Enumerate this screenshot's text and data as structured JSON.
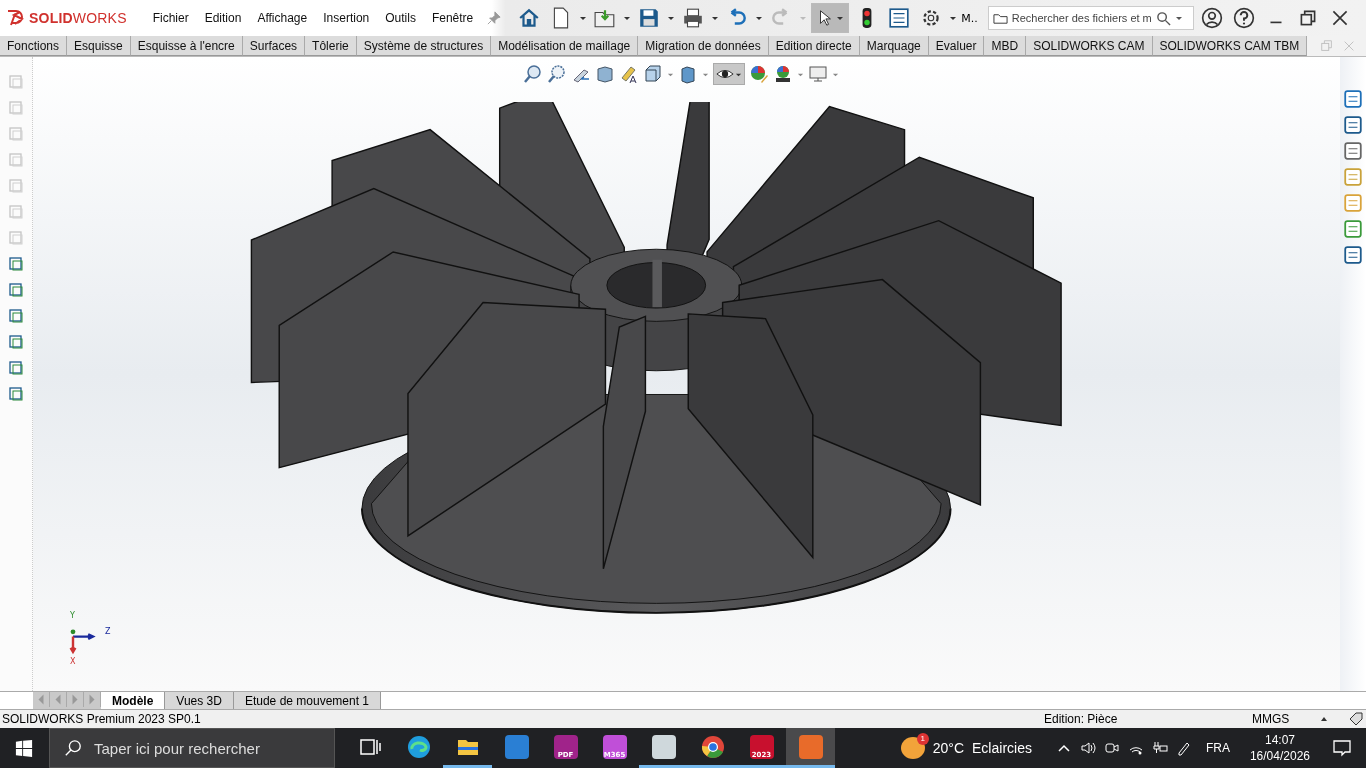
{
  "app": {
    "logo": "**SOLID**WORKS"
  },
  "menu": [
    {
      "label": "Fichier"
    },
    {
      "label": "Edition"
    },
    {
      "label": "Affichage"
    },
    {
      "label": "Insertion"
    },
    {
      "label": "Outils"
    },
    {
      "label": "Fenêtre"
    }
  ],
  "toolbar": {
    "select_active": true,
    "more_label": "M..",
    "search": {
      "placeholder": "Rechercher des fichiers et m"
    }
  },
  "command_tabs": [
    {
      "label": "Fonctions"
    },
    {
      "label": "Esquisse"
    },
    {
      "label": "Esquisse à l'encre"
    },
    {
      "label": "Surfaces"
    },
    {
      "label": "Tôlerie"
    },
    {
      "label": "Système de structures"
    },
    {
      "label": "Modélisation de maillage"
    },
    {
      "label": "Migration de données"
    },
    {
      "label": "Edition directe"
    },
    {
      "label": "Marquage"
    },
    {
      "label": "Evaluer"
    },
    {
      "label": "MBD"
    },
    {
      "label": "SOLIDWORKS CAM"
    },
    {
      "label": "SOLIDWORKS CAM TBM"
    }
  ],
  "triad": {
    "y": "Y",
    "z": "Z",
    "x": "X"
  },
  "model_tabs": [
    {
      "label": "Modèle",
      "selected": true
    },
    {
      "label": "Vues 3D",
      "selected": false
    },
    {
      "label": "Etude de mouvement 1",
      "selected": false
    }
  ],
  "status_bar": {
    "product": "SOLIDWORKS Premium 2023 SP0.1",
    "mode": "Edition: Pièce",
    "units": "MMGS"
  },
  "taskbar": {
    "search": {
      "placeholder": "Taper ici pour rechercher"
    },
    "apps": [
      {
        "kind": "taskview",
        "running": false,
        "active": false
      },
      {
        "kind": "edge",
        "running": false,
        "active": false
      },
      {
        "kind": "folder",
        "running": true,
        "active": false
      },
      {
        "kind": "outlook",
        "running": false,
        "active": false
      },
      {
        "kind": "pdf",
        "label": "PDF",
        "running": false,
        "active": false
      },
      {
        "kind": "m365",
        "label": "M365",
        "running": false,
        "active": false
      },
      {
        "kind": "monitor",
        "running": true,
        "active": false
      },
      {
        "kind": "chrome",
        "running": true,
        "active": false
      },
      {
        "kind": "sw",
        "label": "2023",
        "running": true,
        "active": false
      },
      {
        "kind": "snip",
        "running": true,
        "active": true
      }
    ],
    "weather": {
      "badge": "1",
      "temperature": "20°C",
      "condition": "Eclaircies"
    },
    "language": "FRA",
    "time": "14:07",
    "date": "16/04/2026"
  }
}
